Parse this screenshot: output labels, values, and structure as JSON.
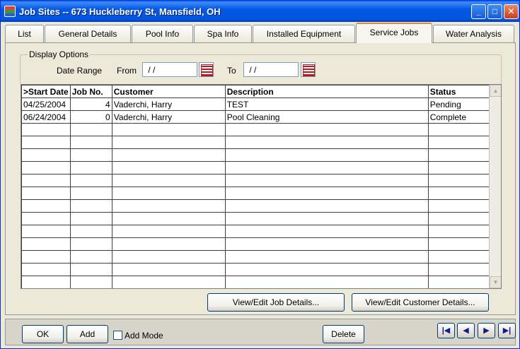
{
  "window": {
    "title": "Job Sites -- 673 Huckleberry St, Mansfield, OH",
    "min_glyph": "_",
    "max_glyph": "□",
    "close_glyph": "✕"
  },
  "tabs": [
    {
      "label": "List"
    },
    {
      "label": "General Details"
    },
    {
      "label": "Pool Info"
    },
    {
      "label": "Spa Info"
    },
    {
      "label": "Installed Equipment"
    },
    {
      "label": "Service Jobs",
      "active": true
    },
    {
      "label": "Water Analysis"
    }
  ],
  "display_options": {
    "legend": "Display Options",
    "date_range_label": "Date Range",
    "from_label": "From",
    "from_value": " / /",
    "to_label": "To",
    "to_value": " / /"
  },
  "grid": {
    "columns": [
      ">Start Date",
      "Job No.",
      "Customer",
      "Description",
      "Status"
    ],
    "rows": [
      [
        "04/25/2004",
        "4",
        "Vaderchi, Harry",
        "TEST",
        "Pending"
      ],
      [
        "06/24/2004",
        "0",
        "Vaderchi, Harry",
        "Pool Cleaning",
        "Complete"
      ]
    ],
    "scroll_up_glyph": "▲",
    "scroll_down_glyph": "▼"
  },
  "buttons": {
    "view_job": "View/Edit Job Details...",
    "view_customer": "View/Edit Customer Details...",
    "ok": "OK",
    "add": "Add",
    "add_mode": "Add Mode",
    "delete": "Delete"
  },
  "nav": {
    "first": "|◀",
    "prev": "◀",
    "next": "▶",
    "last": "▶|"
  },
  "colors": {
    "title_bar": "#0458e2",
    "active_tab_accent": "#e68b2c"
  }
}
